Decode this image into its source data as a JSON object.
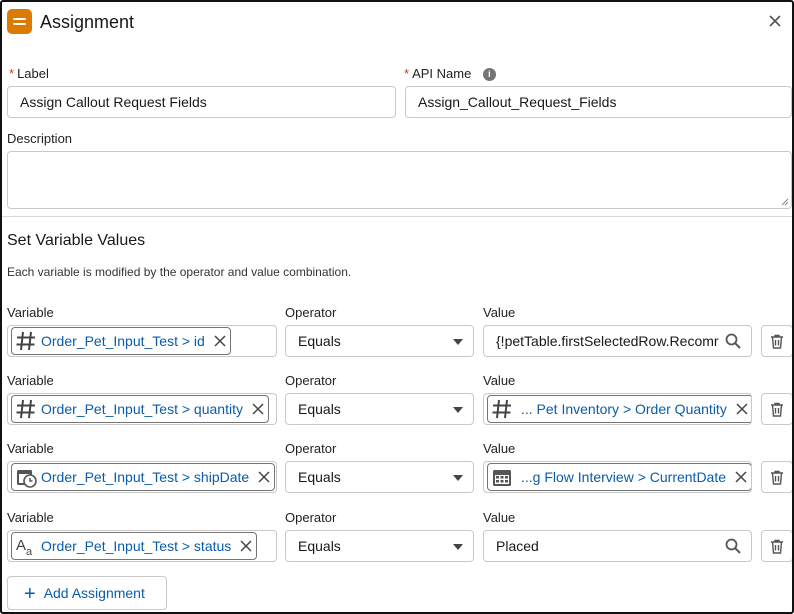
{
  "header": {
    "title": "Assignment",
    "app_icon": "assignment-icon",
    "close_icon": "close-icon"
  },
  "form": {
    "label": {
      "label": "Label",
      "value": "Assign Callout Request Fields",
      "required": "*"
    },
    "api_name": {
      "label": "API Name",
      "value": "Assign_Callout_Request_Fields",
      "required": "*",
      "info_icon": "i"
    },
    "description": {
      "label": "Description",
      "value": ""
    }
  },
  "section": {
    "title": "Set Variable Values",
    "description": "Each variable is modified by the operator and value combination."
  },
  "columns": {
    "variable": "Variable",
    "operator": "Operator",
    "value": "Value"
  },
  "rows": [
    {
      "variable": "Order_Pet_Input_Test > id",
      "variable_icon": "number-icon",
      "operator": "Equals",
      "value": "{!petTable.firstSelectedRow.Recomr",
      "value_type": "text-search"
    },
    {
      "variable": "Order_Pet_Input_Test > quantity",
      "variable_icon": "number-icon",
      "operator": "Equals",
      "value": "... Pet Inventory > Order Quantity",
      "value_icon": "number-icon",
      "value_type": "pill"
    },
    {
      "variable": "Order_Pet_Input_Test > shipDate",
      "variable_icon": "datetime-icon",
      "operator": "Equals",
      "value": "...g Flow Interview > CurrentDate",
      "value_icon": "date-icon",
      "value_type": "pill"
    },
    {
      "variable": "Order_Pet_Input_Test > status",
      "variable_icon": "text-icon",
      "operator": "Equals",
      "value": "Placed",
      "value_type": "text-search"
    }
  ],
  "add_button": {
    "label": "Add Assignment",
    "icon": "plus-icon"
  },
  "colors": {
    "accent": "#0b5cab",
    "app_icon_bg": "#dd7a01",
    "required": "#c23934"
  }
}
